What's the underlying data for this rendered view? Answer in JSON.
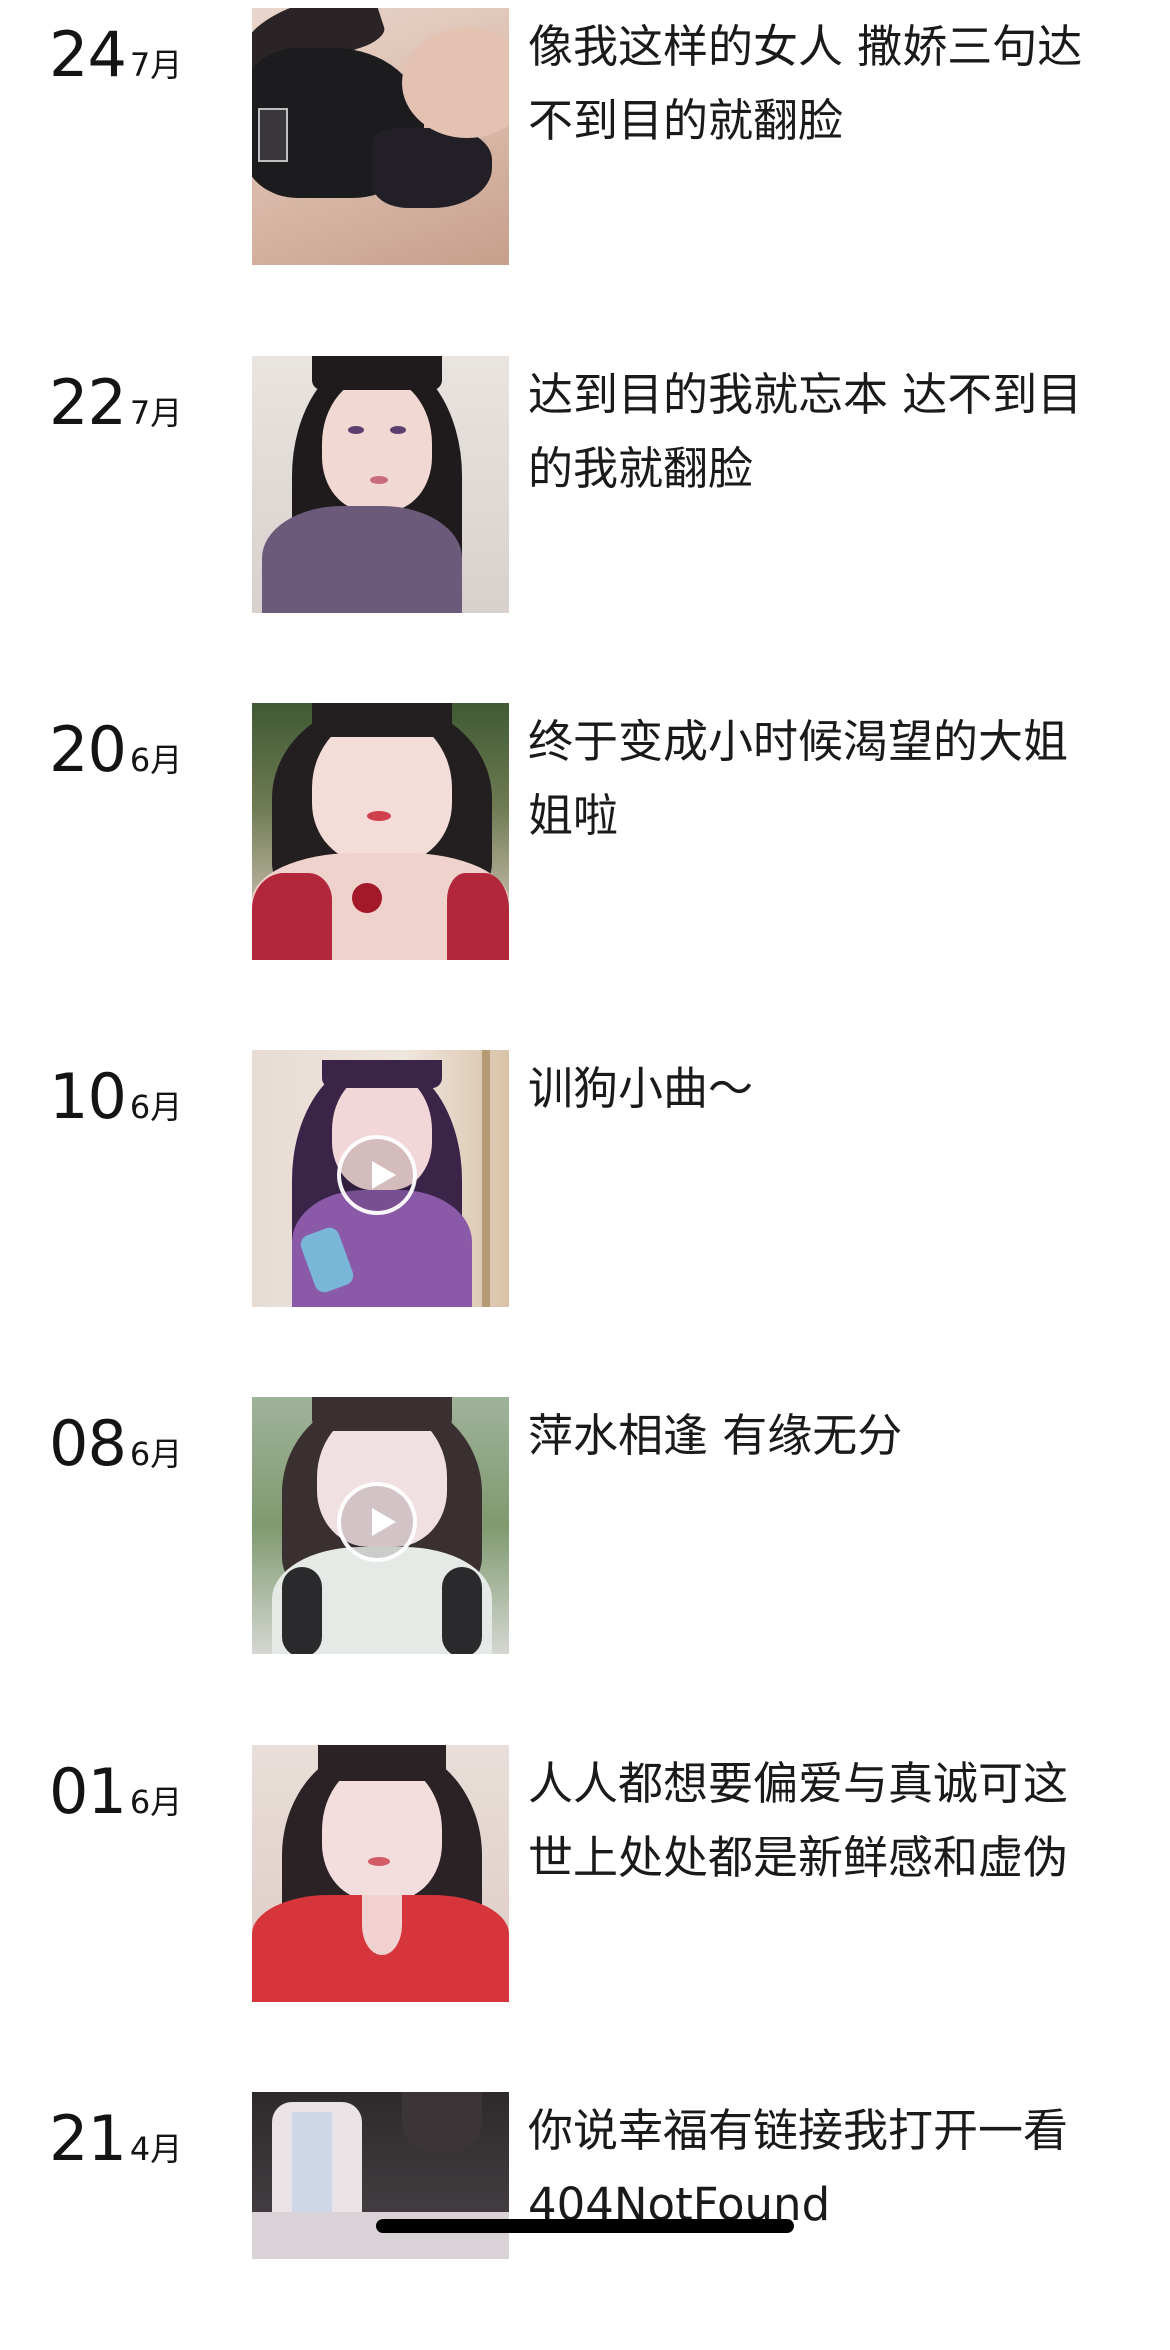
{
  "posts": [
    {
      "day": "24",
      "month": "7月",
      "caption": "像我这样的女人 撒娇三句达不到目的就翻脸",
      "media": "photo"
    },
    {
      "day": "22",
      "month": "7月",
      "caption": "达到目的我就忘本 达不到目的我就翻脸",
      "media": "photo"
    },
    {
      "day": "20",
      "month": "6月",
      "caption": "终于变成小时候渴望的大姐姐啦",
      "media": "photo"
    },
    {
      "day": "10",
      "month": "6月",
      "caption": "训狗小曲～",
      "media": "video"
    },
    {
      "day": "08",
      "month": "6月",
      "caption": "萍水相逢 有缘无分",
      "media": "video"
    },
    {
      "day": "01",
      "month": "6月",
      "caption": "人人都想要偏爱与真诚可这世上处处都是新鲜感和虚伪",
      "media": "photo"
    },
    {
      "day": "21",
      "month": "4月",
      "caption": "你说幸福有链接我打开一看 404NotFound",
      "media": "photo"
    }
  ],
  "icons": {
    "video": "play-icon"
  }
}
